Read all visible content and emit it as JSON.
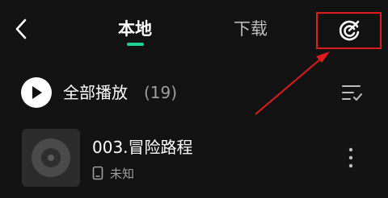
{
  "header": {
    "tabs": [
      {
        "label": "本地",
        "active": true
      },
      {
        "label": "下载",
        "active": false
      }
    ],
    "back_icon": "chevron-left-icon",
    "toolbar_icon": "scan-clean-icon",
    "accent_color": "#1ed28f",
    "highlight_color": "#e01b1b"
  },
  "play_all": {
    "label": "全部播放",
    "count": "(19)",
    "sort_icon": "sort-list-icon"
  },
  "songs": [
    {
      "title": "003.冒险路程",
      "artist": "未知",
      "device_icon": "phone-icon"
    }
  ]
}
